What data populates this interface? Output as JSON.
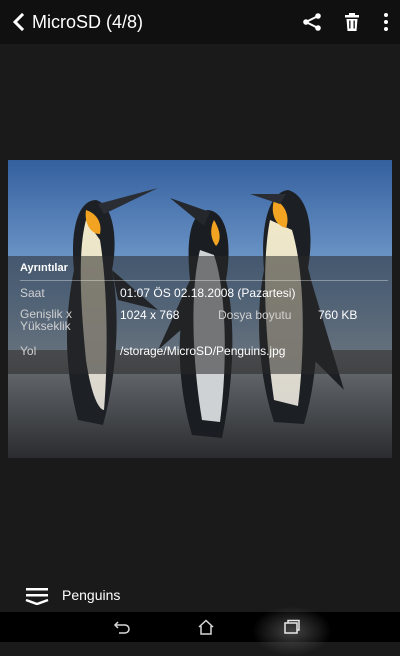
{
  "header": {
    "title": "MicroSD (4/8)",
    "back_icon": "chevron-left-icon",
    "share_icon": "share-icon",
    "delete_icon": "trash-icon",
    "more_icon": "more-vertical-icon"
  },
  "details": {
    "heading": "Ayrıntılar",
    "time_label": "Saat",
    "time_value": "01:07 ÖS 02.18.2008 (Pazartesi)",
    "dims_label_line1": "Genişlik x",
    "dims_label_line2": "Yükseklik",
    "dims_value": "1024 x 768",
    "size_label": "Dosya boyutu",
    "size_value": "760 KB",
    "path_label": "Yol",
    "path_value": "/storage/MicroSD/Penguins.jpg"
  },
  "caption": {
    "text": "Penguins",
    "icon": "menu-lines-icon"
  },
  "navbar": {
    "back_icon": "nav-back-icon",
    "home_icon": "nav-home-icon",
    "recents_icon": "nav-recents-icon"
  },
  "colors": {
    "topbar": "#101010",
    "background": "#1a1a1a",
    "sky_top": "#3a6fb0",
    "sky_bottom": "#a9c6e2",
    "beak_orange": "#f2a321"
  }
}
